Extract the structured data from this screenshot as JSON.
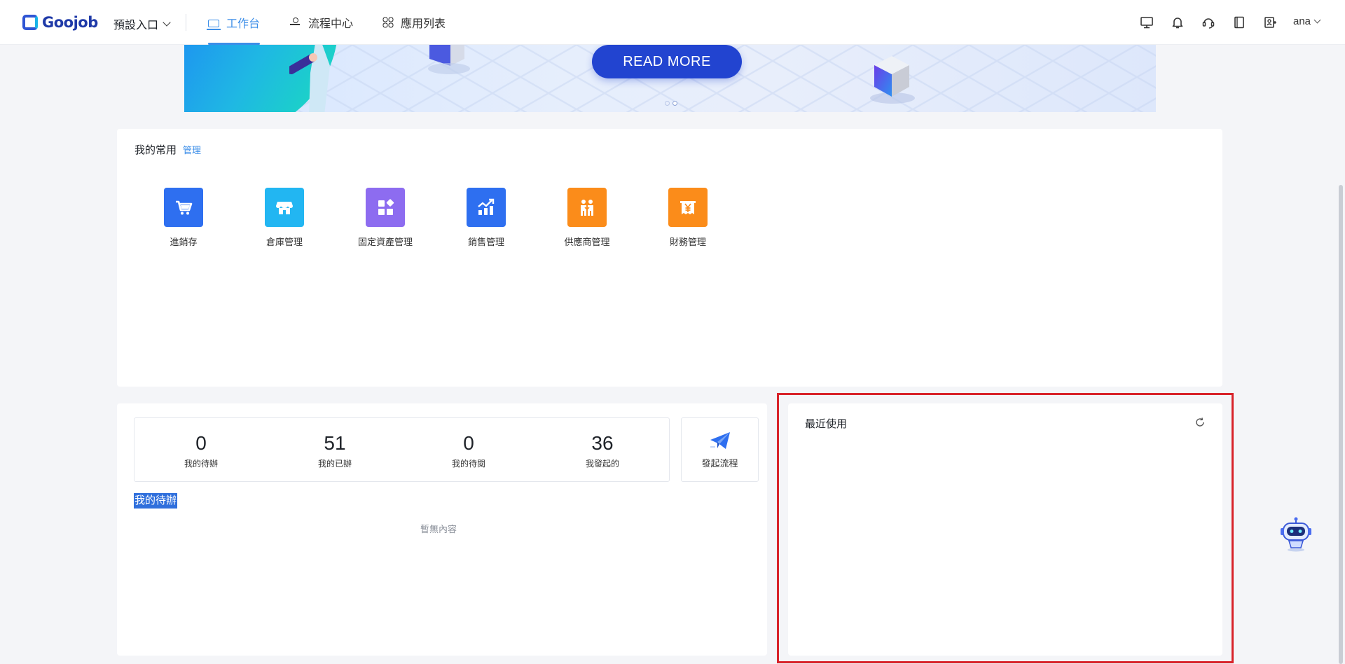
{
  "nav": {
    "logo_text": "Goojob",
    "entry_label": "預設入口",
    "tabs": [
      {
        "label": "工作台",
        "icon": "workbench-icon",
        "active": true
      },
      {
        "label": "流程中心",
        "icon": "flow-icon",
        "active": false
      },
      {
        "label": "應用列表",
        "icon": "apps-icon",
        "active": false
      }
    ],
    "tools": [
      "monitor-icon",
      "bell-icon",
      "headset-icon",
      "book-icon",
      "user-card-icon"
    ],
    "user_name": "ana"
  },
  "banner": {
    "button_label": "READ MORE",
    "slide_count": 2,
    "active_slide": 2
  },
  "favorites": {
    "title": "我的常用",
    "manage_label": "管理",
    "items": [
      {
        "label": "進銷存",
        "icon": "cart-icon",
        "color": "#2e6ff0"
      },
      {
        "label": "倉庫管理",
        "icon": "store-icon",
        "color": "#22b6f2"
      },
      {
        "label": "固定資產管理",
        "icon": "grid-icon",
        "color": "#8d6cf0"
      },
      {
        "label": "銷售管理",
        "icon": "chart-up-icon",
        "color": "#2e6ff0"
      },
      {
        "label": "供應商管理",
        "icon": "handshake-icon",
        "color": "#fb8c1a"
      },
      {
        "label": "財務管理",
        "icon": "yen-icon",
        "color": "#fb8c1a"
      }
    ]
  },
  "tasks": {
    "stats": [
      {
        "value": "0",
        "label": "我的待辦"
      },
      {
        "value": "51",
        "label": "我的已辦"
      },
      {
        "value": "0",
        "label": "我的待閱"
      },
      {
        "value": "36",
        "label": "我發起的"
      }
    ],
    "launch_label": "發起流程",
    "todo_title": "我的待辦",
    "empty_text": "暫無內容"
  },
  "recent": {
    "title": "最近使用"
  },
  "colors": {
    "accent": "#3c8ee8",
    "highlight": "#d8232a",
    "brand": "#1f3aa8"
  }
}
